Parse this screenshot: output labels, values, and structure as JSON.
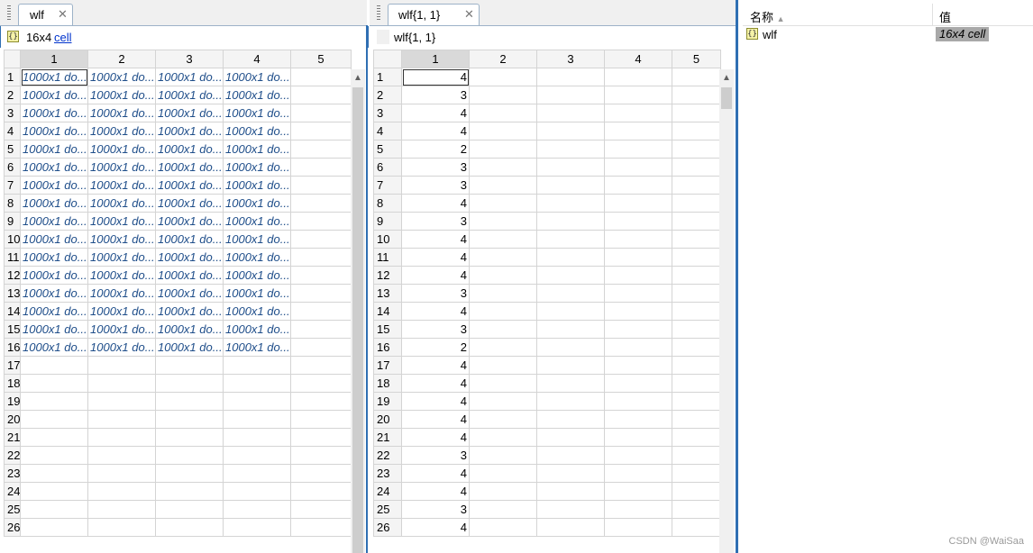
{
  "left_panel": {
    "tab_label": "wlf",
    "close_glyph": "✕",
    "size_text": "16x4",
    "class_link": "cell",
    "columns": [
      "1",
      "2",
      "3",
      "4",
      "5"
    ],
    "rows": [
      {
        "n": "1",
        "c": [
          "1000x1 do...",
          "1000x1 do...",
          "1000x1 do...",
          "1000x1 do...",
          ""
        ]
      },
      {
        "n": "2",
        "c": [
          "1000x1 do...",
          "1000x1 do...",
          "1000x1 do...",
          "1000x1 do...",
          ""
        ]
      },
      {
        "n": "3",
        "c": [
          "1000x1 do...",
          "1000x1 do...",
          "1000x1 do...",
          "1000x1 do...",
          ""
        ]
      },
      {
        "n": "4",
        "c": [
          "1000x1 do...",
          "1000x1 do...",
          "1000x1 do...",
          "1000x1 do...",
          ""
        ]
      },
      {
        "n": "5",
        "c": [
          "1000x1 do...",
          "1000x1 do...",
          "1000x1 do...",
          "1000x1 do...",
          ""
        ]
      },
      {
        "n": "6",
        "c": [
          "1000x1 do...",
          "1000x1 do...",
          "1000x1 do...",
          "1000x1 do...",
          ""
        ]
      },
      {
        "n": "7",
        "c": [
          "1000x1 do...",
          "1000x1 do...",
          "1000x1 do...",
          "1000x1 do...",
          ""
        ]
      },
      {
        "n": "8",
        "c": [
          "1000x1 do...",
          "1000x1 do...",
          "1000x1 do...",
          "1000x1 do...",
          ""
        ]
      },
      {
        "n": "9",
        "c": [
          "1000x1 do...",
          "1000x1 do...",
          "1000x1 do...",
          "1000x1 do...",
          ""
        ]
      },
      {
        "n": "10",
        "c": [
          "1000x1 do...",
          "1000x1 do...",
          "1000x1 do...",
          "1000x1 do...",
          ""
        ]
      },
      {
        "n": "11",
        "c": [
          "1000x1 do...",
          "1000x1 do...",
          "1000x1 do...",
          "1000x1 do...",
          ""
        ]
      },
      {
        "n": "12",
        "c": [
          "1000x1 do...",
          "1000x1 do...",
          "1000x1 do...",
          "1000x1 do...",
          ""
        ]
      },
      {
        "n": "13",
        "c": [
          "1000x1 do...",
          "1000x1 do...",
          "1000x1 do...",
          "1000x1 do...",
          ""
        ]
      },
      {
        "n": "14",
        "c": [
          "1000x1 do...",
          "1000x1 do...",
          "1000x1 do...",
          "1000x1 do...",
          ""
        ]
      },
      {
        "n": "15",
        "c": [
          "1000x1 do...",
          "1000x1 do...",
          "1000x1 do...",
          "1000x1 do...",
          ""
        ]
      },
      {
        "n": "16",
        "c": [
          "1000x1 do...",
          "1000x1 do...",
          "1000x1 do...",
          "1000x1 do...",
          ""
        ]
      },
      {
        "n": "17",
        "c": [
          "",
          "",
          "",
          "",
          ""
        ]
      },
      {
        "n": "18",
        "c": [
          "",
          "",
          "",
          "",
          ""
        ]
      },
      {
        "n": "19",
        "c": [
          "",
          "",
          "",
          "",
          ""
        ]
      },
      {
        "n": "20",
        "c": [
          "",
          "",
          "",
          "",
          ""
        ]
      },
      {
        "n": "21",
        "c": [
          "",
          "",
          "",
          "",
          ""
        ]
      },
      {
        "n": "22",
        "c": [
          "",
          "",
          "",
          "",
          ""
        ]
      },
      {
        "n": "23",
        "c": [
          "",
          "",
          "",
          "",
          ""
        ]
      },
      {
        "n": "24",
        "c": [
          "",
          "",
          "",
          "",
          ""
        ]
      },
      {
        "n": "25",
        "c": [
          "",
          "",
          "",
          "",
          ""
        ]
      },
      {
        "n": "26",
        "c": [
          "",
          "",
          "",
          "",
          ""
        ]
      }
    ]
  },
  "mid_panel": {
    "tab_label": "wlf{1, 1}",
    "close_glyph": "✕",
    "subtitle": "wlf{1, 1}",
    "columns": [
      "1",
      "2",
      "3",
      "4",
      "5"
    ],
    "rows": [
      {
        "n": "1",
        "v": "4"
      },
      {
        "n": "2",
        "v": "3"
      },
      {
        "n": "3",
        "v": "4"
      },
      {
        "n": "4",
        "v": "4"
      },
      {
        "n": "5",
        "v": "2"
      },
      {
        "n": "6",
        "v": "3"
      },
      {
        "n": "7",
        "v": "3"
      },
      {
        "n": "8",
        "v": "4"
      },
      {
        "n": "9",
        "v": "3"
      },
      {
        "n": "10",
        "v": "4"
      },
      {
        "n": "11",
        "v": "4"
      },
      {
        "n": "12",
        "v": "4"
      },
      {
        "n": "13",
        "v": "3"
      },
      {
        "n": "14",
        "v": "4"
      },
      {
        "n": "15",
        "v": "3"
      },
      {
        "n": "16",
        "v": "2"
      },
      {
        "n": "17",
        "v": "4"
      },
      {
        "n": "18",
        "v": "4"
      },
      {
        "n": "19",
        "v": "4"
      },
      {
        "n": "20",
        "v": "4"
      },
      {
        "n": "21",
        "v": "4"
      },
      {
        "n": "22",
        "v": "3"
      },
      {
        "n": "23",
        "v": "4"
      },
      {
        "n": "24",
        "v": "4"
      },
      {
        "n": "25",
        "v": "3"
      },
      {
        "n": "26",
        "v": "4"
      }
    ]
  },
  "workspace": {
    "col_name": "名称",
    "col_value": "值",
    "var_name": "wlf",
    "var_value": "16x4 cell"
  },
  "watermark": "CSDN @WaiSaa",
  "colors": {
    "accent_blue": "#2f6fb3",
    "cell_text": "#1f4e8a",
    "link": "#0033cc"
  }
}
